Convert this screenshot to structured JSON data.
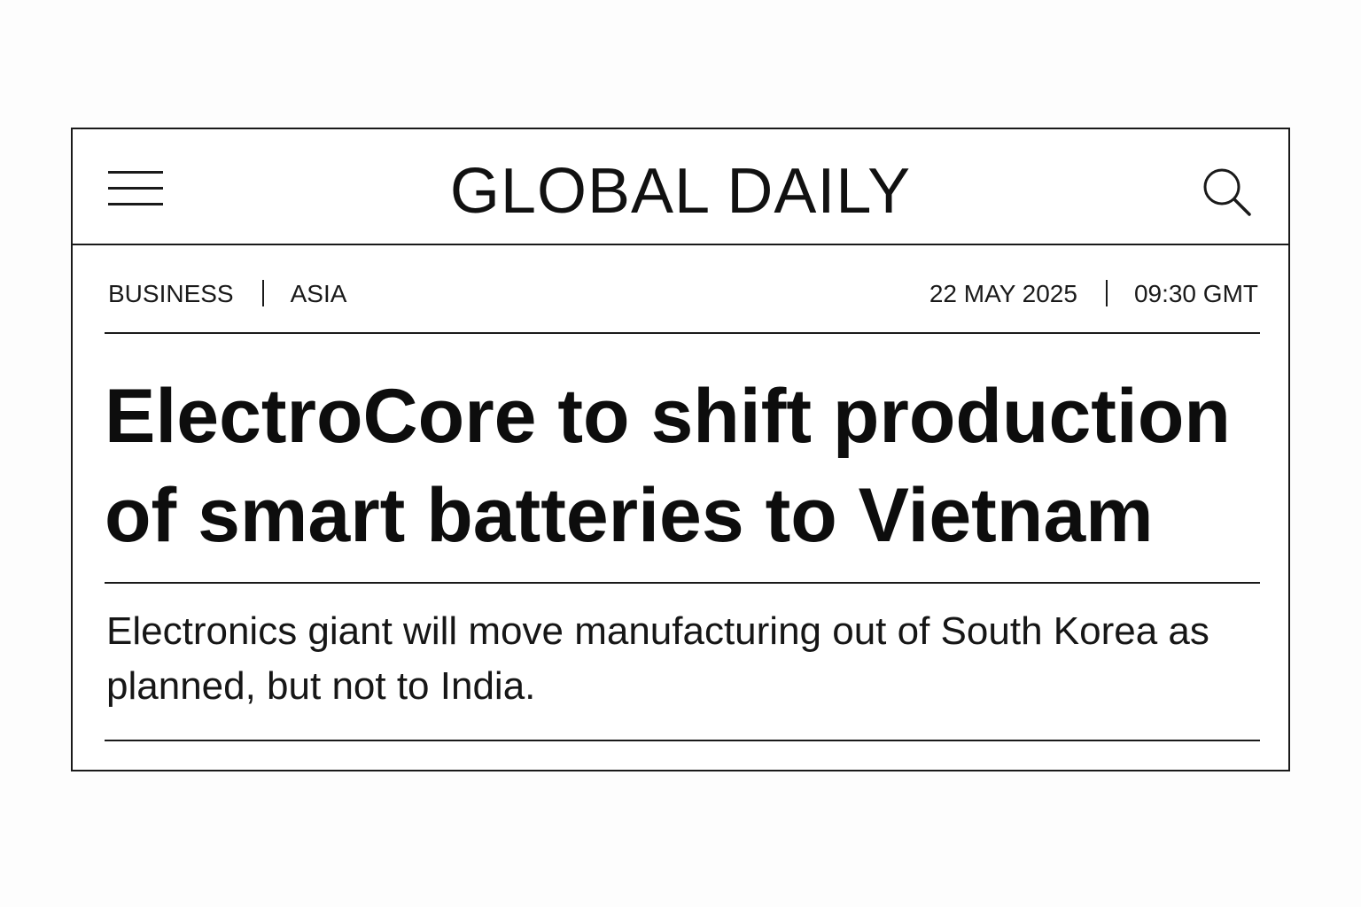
{
  "header": {
    "menu_icon": "hamburger-menu-icon",
    "brand": "GLOBAL DAILY",
    "search_icon": "search-icon"
  },
  "article": {
    "section": "BUSINESS",
    "region": "ASIA",
    "date": "22 MAY 2025",
    "time": "09:30 GMT",
    "headline": "ElectroCore to shift production of smart batteries to Vietnam",
    "standfirst": "Electronics giant will move manufacturing out of South Korea as planned, but not to India."
  }
}
